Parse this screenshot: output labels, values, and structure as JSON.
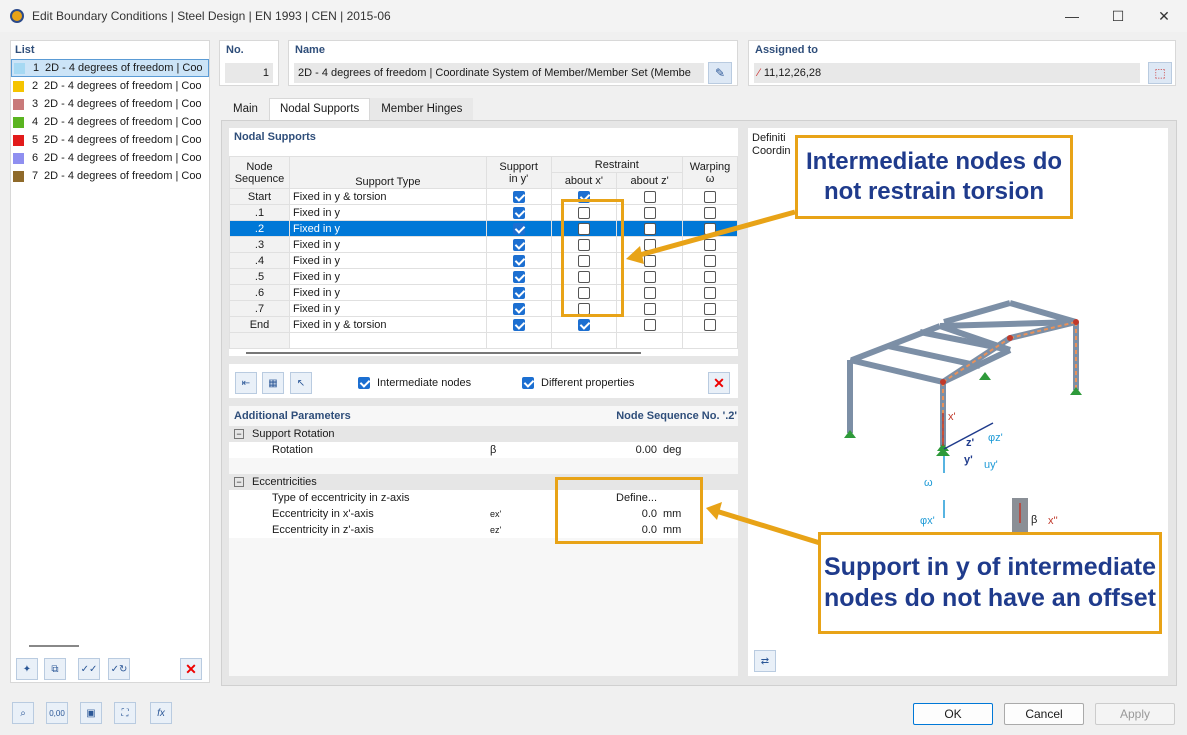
{
  "window": {
    "title": "Edit Boundary Conditions | Steel Design | EN 1993 | CEN | 2015-06"
  },
  "list": {
    "header": "List",
    "items": [
      {
        "num": "1",
        "label": "2D - 4 degrees of freedom | Coo",
        "color": "#a6d9f3"
      },
      {
        "num": "2",
        "label": "2D - 4 degrees of freedom | Coo",
        "color": "#f5c400"
      },
      {
        "num": "3",
        "label": "2D - 4 degrees of freedom | Coo",
        "color": "#c97a7a"
      },
      {
        "num": "4",
        "label": "2D - 4 degrees of freedom | Coo",
        "color": "#5ab420"
      },
      {
        "num": "5",
        "label": "2D - 4 degrees of freedom | Coo",
        "color": "#e21b1b"
      },
      {
        "num": "6",
        "label": "2D - 4 degrees of freedom | Coo",
        "color": "#8f8ff0"
      },
      {
        "num": "7",
        "label": "2D - 4 degrees of freedom | Coo",
        "color": "#8f6a2a"
      }
    ]
  },
  "header": {
    "no_label": "No.",
    "no_value": "1",
    "name_label": "Name",
    "name_value": "2D - 4 degrees of freedom | Coordinate System of Member/Member Set (Membe",
    "assigned_label": "Assigned to",
    "assigned_value": "11,12,26,28"
  },
  "tabs": [
    "Main",
    "Nodal Supports",
    "Member Hinges"
  ],
  "nodal_supports": {
    "title": "Nodal Supports",
    "columns": {
      "node_seq_1": "Node",
      "node_seq_2": "Sequence",
      "support_type": "Support Type",
      "support_1": "Support",
      "support_2": "in y'",
      "restraint": "Restraint",
      "about_x": "about x'",
      "about_z": "about z'",
      "warping_1": "Warping",
      "warping_2": "ω"
    },
    "rows": [
      {
        "seq": "Start",
        "type": "Fixed in y & torsion",
        "support": true,
        "rx": true,
        "rz": false,
        "w": false
      },
      {
        "seq": ".1",
        "type": "Fixed in y",
        "support": true,
        "rx": false,
        "rz": false,
        "w": false
      },
      {
        "seq": ".2",
        "type": "Fixed in y",
        "support": true,
        "rx": false,
        "rz": false,
        "w": false
      },
      {
        "seq": ".3",
        "type": "Fixed in y",
        "support": true,
        "rx": false,
        "rz": false,
        "w": false
      },
      {
        "seq": ".4",
        "type": "Fixed in y",
        "support": true,
        "rx": false,
        "rz": false,
        "w": false
      },
      {
        "seq": ".5",
        "type": "Fixed in y",
        "support": true,
        "rx": false,
        "rz": false,
        "w": false
      },
      {
        "seq": ".6",
        "type": "Fixed in y",
        "support": true,
        "rx": false,
        "rz": false,
        "w": false
      },
      {
        "seq": ".7",
        "type": "Fixed in y",
        "support": true,
        "rx": false,
        "rz": false,
        "w": false
      },
      {
        "seq": "End",
        "type": "Fixed in y & torsion",
        "support": true,
        "rx": true,
        "rz": false,
        "w": false
      }
    ],
    "intermediate_nodes": "Intermediate nodes",
    "different_properties": "Different properties"
  },
  "additional": {
    "title": "Additional Parameters",
    "node_seq": "Node Sequence No. '.2'",
    "support_rotation": "Support Rotation",
    "rotation_label": "Rotation",
    "rotation_sym": "β",
    "rotation_val": "0.00",
    "rotation_unit": "deg",
    "eccentricities": "Eccentricities",
    "ecc_type_label": "Type of eccentricity in z-axis",
    "ecc_type_val": "Define...",
    "ecc_x_label": "Eccentricity in x'-axis",
    "ecc_x_sym": "ex'",
    "ecc_x_val": "0.0",
    "ecc_x_unit": "mm",
    "ecc_z_label": "Eccentricity in z'-axis",
    "ecc_z_sym": "ez'",
    "ecc_z_val": "0.0",
    "ecc_z_unit": "mm"
  },
  "preview": {
    "line1": "Definiti",
    "line2": "Coordin",
    "labels": {
      "x": "x'",
      "z": "z'",
      "y": "y'",
      "phiz": "φz'",
      "uy": "uy'",
      "omega": "ω",
      "phix": "φx'",
      "beta": "β",
      "x2": "x''"
    }
  },
  "callouts": {
    "top": "Intermediate nodes do not restrain torsion",
    "bottom": "Support in y of intermediate nodes do not have an offset"
  },
  "buttons": {
    "ok": "OK",
    "cancel": "Cancel",
    "apply": "Apply"
  },
  "status_icons": {
    "zero": "0,00"
  }
}
